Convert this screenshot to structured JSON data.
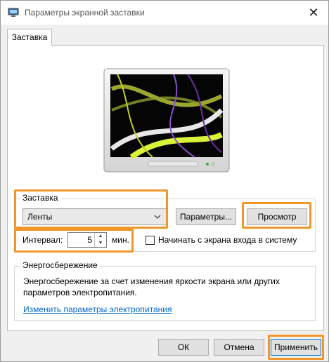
{
  "window": {
    "title": "Параметры экранной заставки",
    "close_glyph": "✕"
  },
  "tabs": [
    {
      "label": "Заставка"
    }
  ],
  "screensaver": {
    "group_label": "Заставка",
    "selected": "Ленты",
    "settings_button": "Параметры...",
    "preview_button": "Просмотр"
  },
  "interval": {
    "label": "Интервал:",
    "value": "5",
    "unit": "мин."
  },
  "logon_checkbox": {
    "label": "Начинать с экрана входа в систему",
    "checked": false
  },
  "power": {
    "group_label": "Энергосбережение",
    "description_line1": "Энергосбережение за счет изменения яркости экрана или других",
    "description_line2": "параметров электропитания.",
    "link": "Изменить параметры электропитания"
  },
  "footer": {
    "ok": "ОК",
    "cancel": "Отмена",
    "apply": "Применить"
  },
  "colors": {
    "highlight": "#f0962a",
    "link": "#0066cc",
    "accent": "#0078d7"
  },
  "icons": {
    "window": "monitor-icon",
    "close": "close-icon",
    "dropdown": "chevron-down-icon",
    "spin_up": "arrow-up-icon",
    "spin_down": "arrow-down-icon"
  }
}
